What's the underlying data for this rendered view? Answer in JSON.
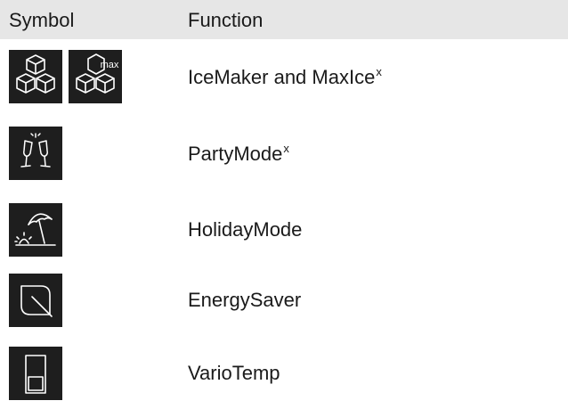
{
  "table": {
    "header": {
      "symbol": "Symbol",
      "function": "Function"
    },
    "rows": [
      {
        "label": "IceMaker and MaxIce",
        "superscript": "x",
        "icons": [
          "ice-cubes-icon",
          "max-ice-cubes-icon"
        ]
      },
      {
        "label": "PartyMode",
        "superscript": "x",
        "icons": [
          "champagne-glasses-icon"
        ]
      },
      {
        "label": "HolidayMode",
        "superscript": "",
        "icons": [
          "beach-umbrella-sunset-icon"
        ]
      },
      {
        "label": "EnergySaver",
        "superscript": "",
        "icons": [
          "leaf-icon"
        ]
      },
      {
        "label": "VarioTemp",
        "superscript": "",
        "icons": [
          "vario-temp-drawer-icon"
        ]
      }
    ],
    "max_icon_text": "max"
  },
  "colors": {
    "header_background": "#e6e6e6",
    "icon_background": "#1e1e1e",
    "icon_stroke": "#ffffff",
    "text": "#1a1a1a"
  }
}
